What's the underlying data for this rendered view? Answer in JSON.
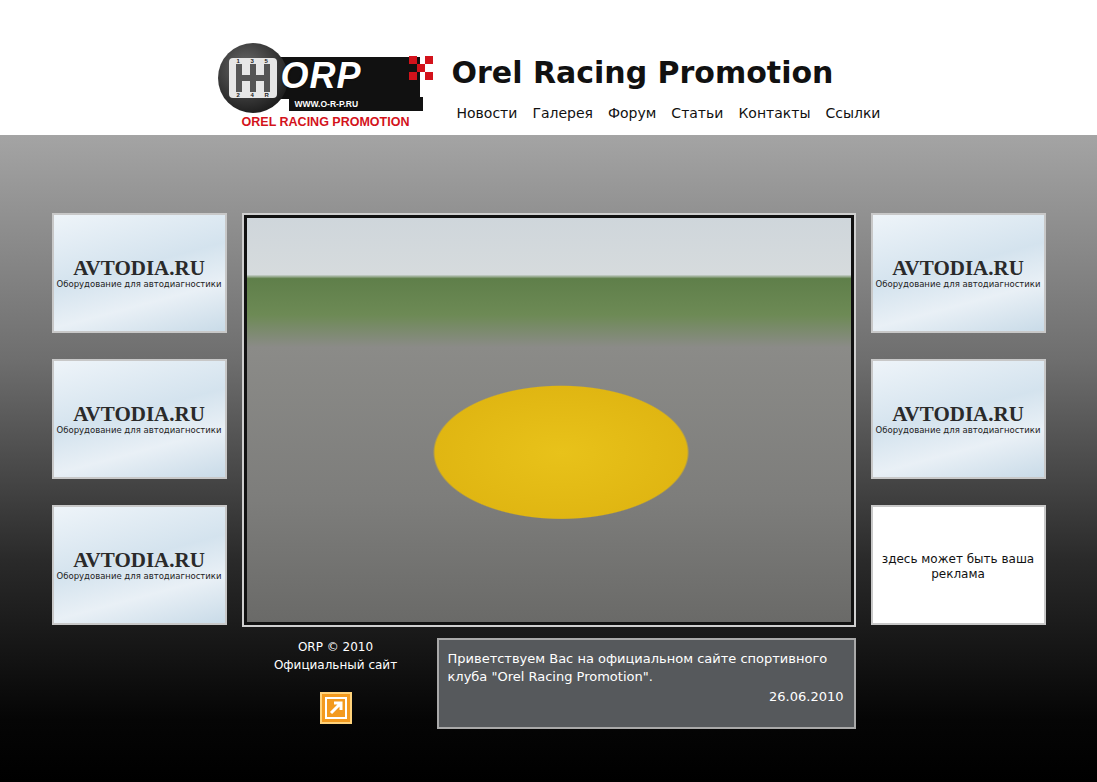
{
  "logo": {
    "mark": "ORP",
    "url": "WWW.O-R-P.RU",
    "name": "OREL RACING PROMOTION",
    "gears": [
      "1",
      "3",
      "5",
      "2",
      "4",
      "R"
    ]
  },
  "title": "Orel Racing Promotion",
  "nav": [
    "Новости",
    "Галерея",
    "Форум",
    "Статьи",
    "Контакты",
    "Ссылки"
  ],
  "ads_left": [
    {
      "kind": "brand",
      "title": "AVTODIA.RU",
      "subtitle": "Оборудование для автодиагностики"
    },
    {
      "kind": "brand",
      "title": "AVTODIA.RU",
      "subtitle": "Оборудование для автодиагностики"
    },
    {
      "kind": "brand",
      "title": "AVTODIA.RU",
      "subtitle": "Оборудование для автодиагностики"
    }
  ],
  "ads_right": [
    {
      "kind": "brand",
      "title": "AVTODIA.RU",
      "subtitle": "Оборудование для автодиагностики"
    },
    {
      "kind": "brand",
      "title": "AVTODIA.RU",
      "subtitle": "Оборудование для автодиагностики"
    },
    {
      "kind": "placeholder",
      "text": "здесь может быть ваша реклама"
    }
  ],
  "footer": {
    "copyright": "ORP © 2010",
    "caption": "Официальный сайт"
  },
  "news": {
    "text": "Приветствуем Вас на официальном сайте спортивного клуба \"Orel Racing Promotion\".",
    "date": "26.06.2010"
  }
}
